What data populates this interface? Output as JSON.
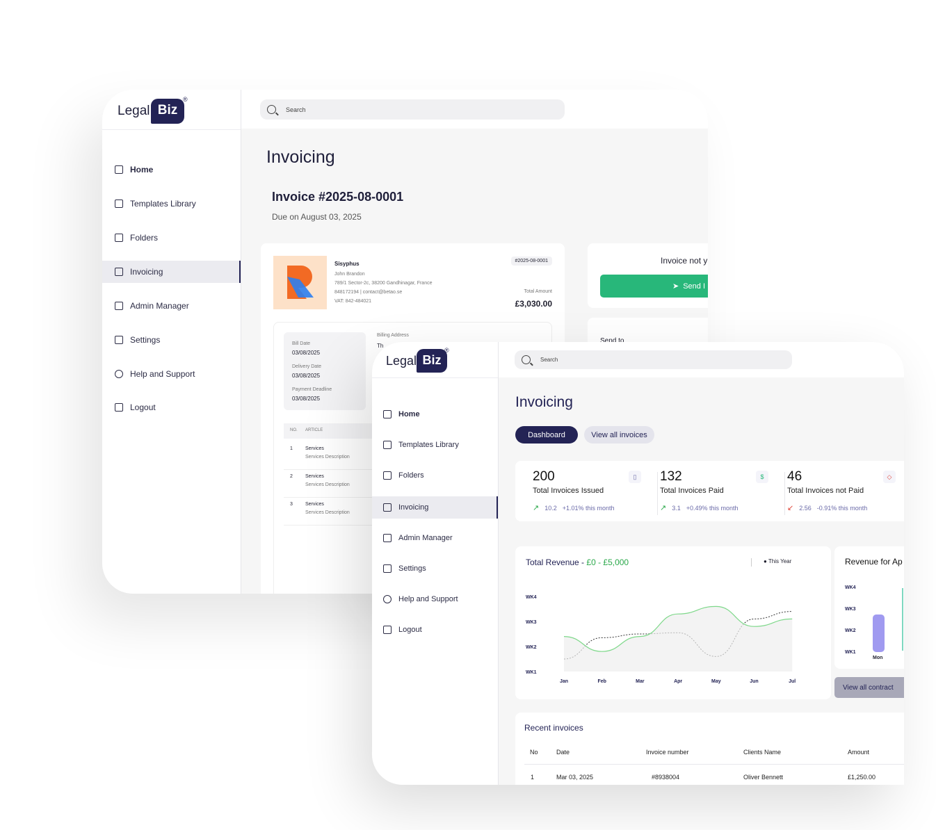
{
  "brand": {
    "word": "Legal",
    "badge": "Biz",
    "reg": "®"
  },
  "search": {
    "placeholder": "Search"
  },
  "nav": [
    "Home",
    "Templates Library",
    "Folders",
    "Invoicing",
    "Admin Manager",
    "Settings",
    "Help and Support",
    "Logout"
  ],
  "w1": {
    "page_title": "Invoicing",
    "invoice_title": "Invoice #2025-08-0001",
    "due": "Due on August 03, 2025",
    "company": "Sisyphus",
    "contact": "John Brandon",
    "address": "789/1 Sector-2c, 38200 Gandhinagar, France",
    "phone_mail": "848172194 | contact@betao.se",
    "vat": "VAT: 842-484021",
    "tag": "#2025-08-0001",
    "total_label": "Total Amount",
    "total": "£3,030.00",
    "bill_date_label": "Bill Date",
    "bill_date": "03/08/2025",
    "delivery_label": "Delivery Date",
    "delivery": "03/08/2025",
    "deadline_label": "Payment Deadline",
    "deadline": "03/08/2025",
    "billing_label": "Billing Address",
    "billing_partial": "Th",
    "col_no": "NO.",
    "col_article": "ARTICLE",
    "rows": [
      {
        "no": "1",
        "title": "Services",
        "desc": "Services Description"
      },
      {
        "no": "2",
        "title": "Services",
        "desc": "Services Description"
      },
      {
        "no": "3",
        "title": "Services",
        "desc": "Services Description"
      }
    ],
    "status_partial": "Invoice not y",
    "send_partial": "Send I",
    "send_label_partial": "Send to"
  },
  "w2": {
    "page_title": "Invoicing",
    "tabs": [
      "Dashboard",
      "View all invoices"
    ],
    "stats": [
      {
        "num": "200",
        "label": "Total Invoices Issued",
        "delta": "10.2",
        "pct": "+1.01% this month",
        "dir": "up"
      },
      {
        "num": "132",
        "label": "Total Invoices Paid",
        "delta": "3.1",
        "pct": "+0.49% this month",
        "dir": "up"
      },
      {
        "num": "46",
        "label": "Total Invoices not Paid",
        "delta": "2.56",
        "pct": "-0.91% this month",
        "dir": "down"
      }
    ],
    "revenue_title": "Total Revenue - ",
    "revenue_range": "£0 - £5,000",
    "legend": "This Year",
    "revenue_apr": "Revenue for Ap",
    "apr_y": [
      "WK4",
      "WK3",
      "WK2",
      "WK1"
    ],
    "apr_x": "Mon",
    "view_contracts": "View all contract",
    "recent_title": "Recent invoices",
    "table_headers": [
      "No",
      "Date",
      "Invoice number",
      "Clients Name",
      "Amount"
    ],
    "table_rows": [
      [
        "1",
        "Mar 03, 2025",
        "#8938004",
        "Oliver Bennett",
        "£1,250.00"
      ]
    ]
  },
  "chart_data": {
    "type": "line",
    "title": "Total Revenue - £0 - £5,000",
    "categories": [
      "Jan",
      "Feb",
      "Mar",
      "Apr",
      "May",
      "Jun",
      "Jul"
    ],
    "y_ticks": [
      "WK1",
      "WK2",
      "WK3",
      "WK4"
    ],
    "series": [
      {
        "name": "This Year",
        "style": "dotted",
        "color": "#333333",
        "values": [
          1.5,
          2.35,
          2.5,
          2.55,
          1.6,
          3.1,
          3.4
        ]
      },
      {
        "name": "",
        "style": "solid",
        "color": "#7ed88a",
        "values": [
          2.4,
          1.8,
          2.4,
          3.3,
          3.6,
          2.8,
          3.1
        ]
      }
    ]
  }
}
